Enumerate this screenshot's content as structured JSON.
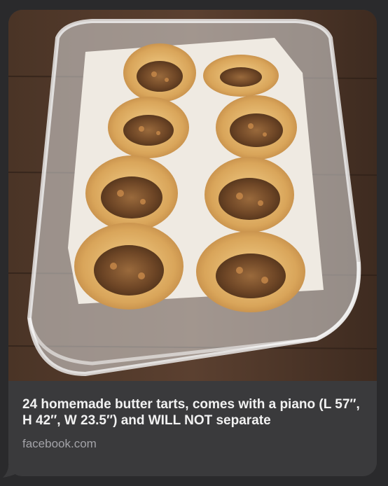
{
  "link_preview": {
    "title": "24 homemade butter tarts, comes with a piano (L 57″, H 42″, W 23.5″) and WILL NOT separate",
    "domain": "facebook.com"
  },
  "colors": {
    "background": "#2a2a2c",
    "bubble": "#3a3a3c",
    "title_text": "#f2f2f2",
    "domain_text": "#a3a3a8"
  }
}
